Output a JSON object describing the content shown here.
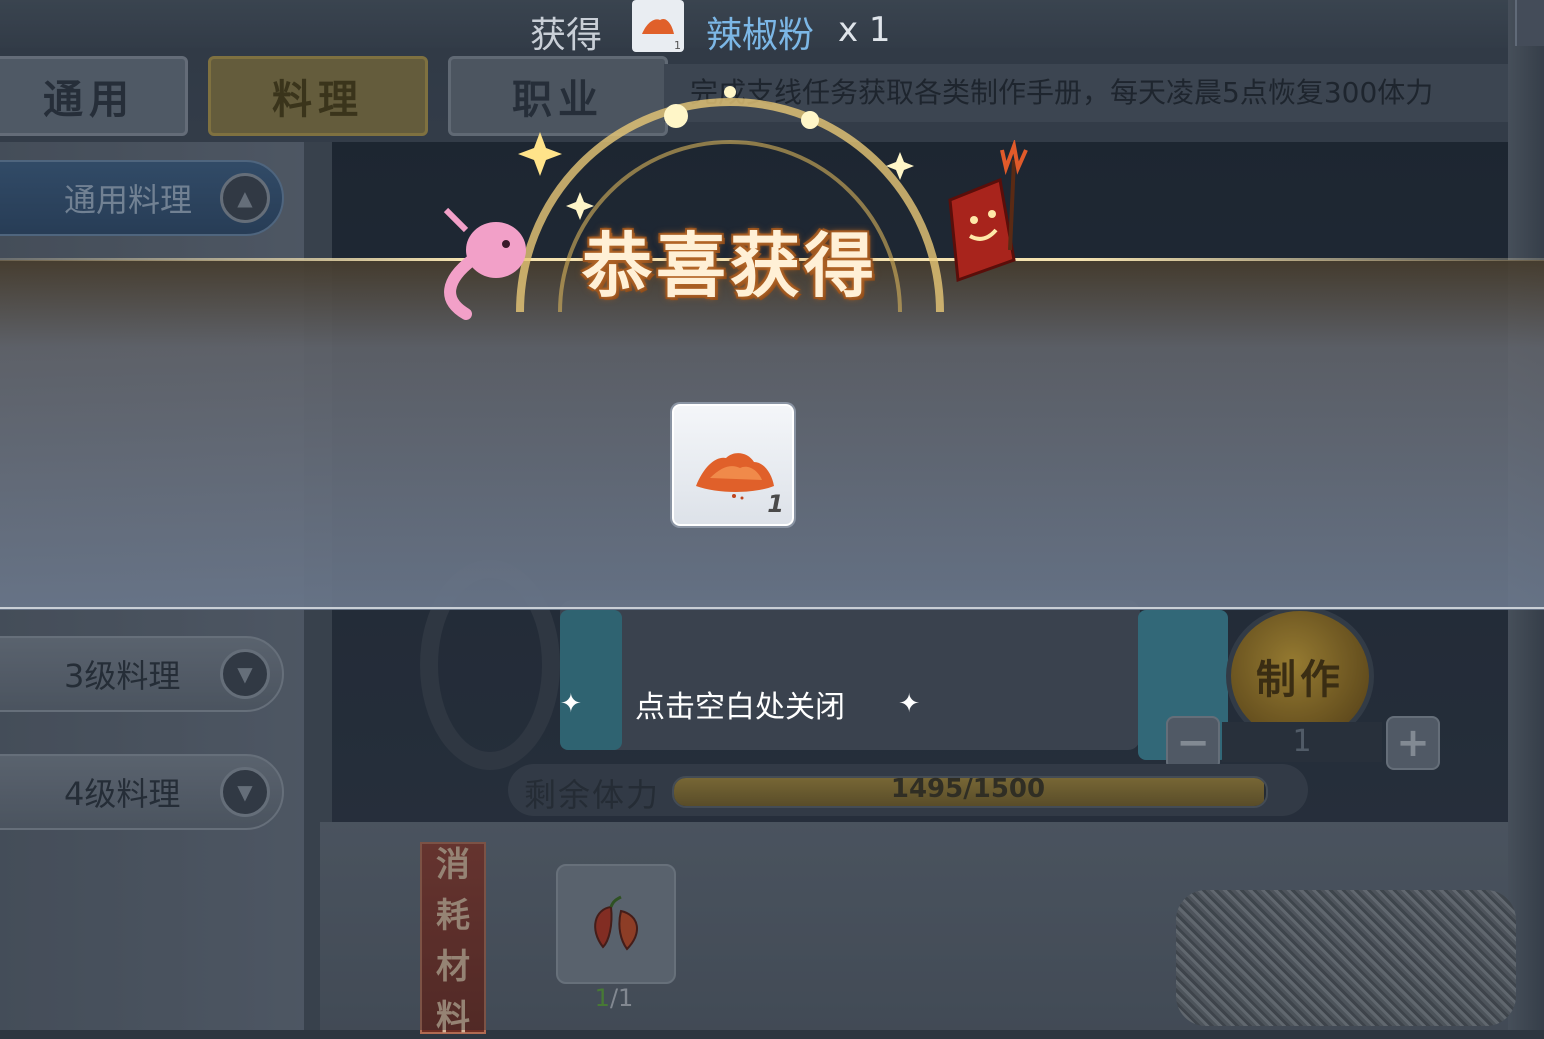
{
  "obtain_bar": {
    "label": "获得",
    "item_name": "辣椒粉",
    "quantity": "x 1",
    "icon_count": "1"
  },
  "tabs": [
    {
      "label": "通用"
    },
    {
      "label": "料理"
    },
    {
      "label": "职业"
    }
  ],
  "tip_text": "完成支线任务获取各类制作手册，每天凌晨5点恢复300体力",
  "sidebar": {
    "items": [
      {
        "label": "通用料理"
      },
      {
        "label": "3级料理"
      },
      {
        "label": "4级料理"
      }
    ]
  },
  "reward_popup": {
    "title": "恭喜获得",
    "item_count": "1",
    "close_hint": "点击空白处关闭"
  },
  "crafting": {
    "make_label": "制作",
    "quantity": "1",
    "minus_label": "−",
    "plus_label": "+"
  },
  "stamina": {
    "label": "剩余体力",
    "text": "1495/1500",
    "current": 1495,
    "max": 1500
  },
  "materials": {
    "banner": [
      "消",
      "耗",
      "材",
      "料"
    ],
    "have": "1",
    "need": "/1"
  },
  "colors": {
    "item_name": "#7cb7e6",
    "title_glow": "#b86a2a",
    "material_have": "#5fa63a"
  }
}
